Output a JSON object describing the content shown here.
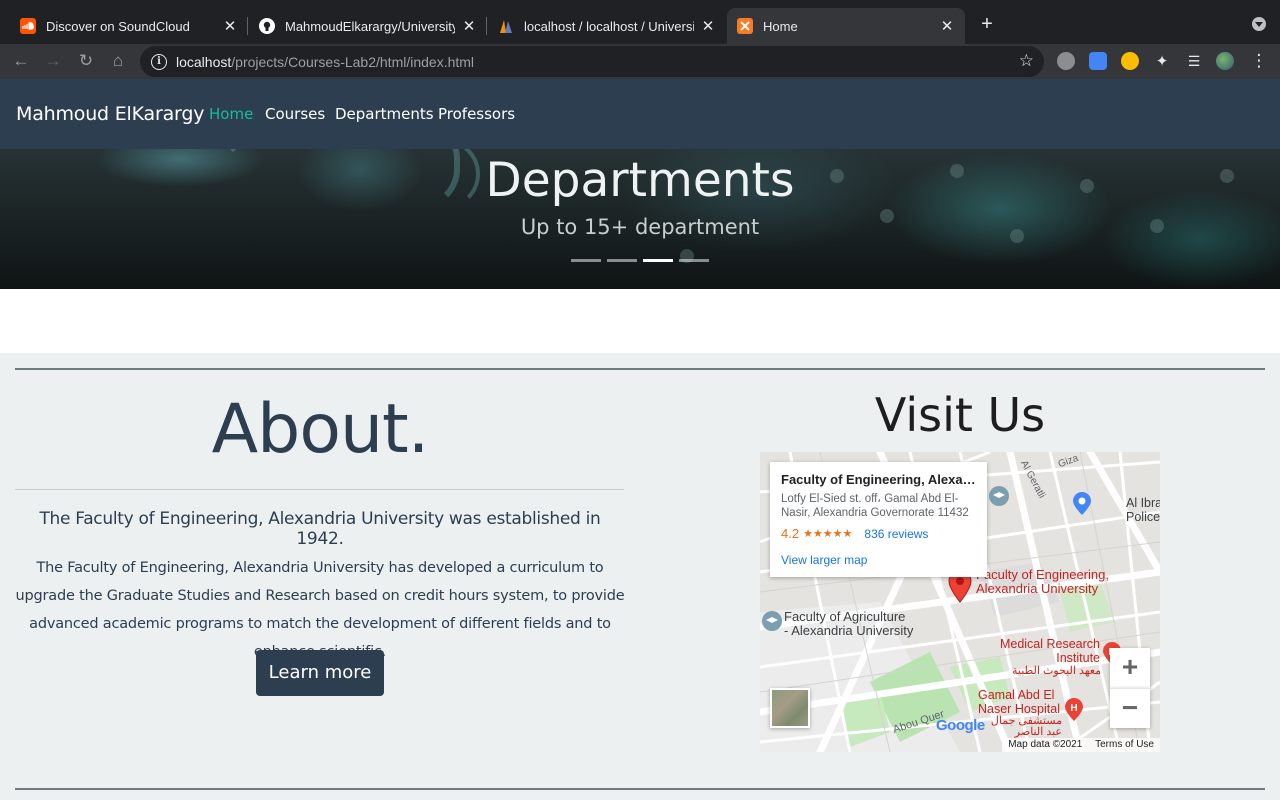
{
  "browser": {
    "tabs": [
      {
        "title": "Discover on SoundCloud",
        "favicon": "soundcloud-icon",
        "active": false
      },
      {
        "title": "MahmoudElkarargy/University-",
        "favicon": "github-icon",
        "active": false
      },
      {
        "title": "localhost / localhost / Universit",
        "favicon": "phpmyadmin-icon",
        "active": false
      },
      {
        "title": "Home",
        "favicon": "xampp-icon",
        "active": true
      }
    ],
    "url_host": "localhost",
    "url_path": "/projects/Courses-Lab2/html/index.html"
  },
  "nav": {
    "brand": "Mahmoud ElKarargy",
    "links": [
      {
        "label": "Home",
        "active": true
      },
      {
        "label": "Courses",
        "active": false
      },
      {
        "label": "Departments",
        "active": false
      },
      {
        "label": "Professors",
        "active": false
      }
    ]
  },
  "hero": {
    "title": "Departments",
    "subtitle": "Up to 15+ department",
    "slide_count": 4,
    "active_slide": 3
  },
  "about": {
    "title": "About.",
    "lead": "The Faculty of Engineering, Alexandria University was established in 1942.",
    "body": "The Faculty of Engineering, Alexandria University has developed a curriculum to upgrade the Graduate Studies and Research based on credit hours system, to provide advanced academic programs to match the development of different fields and to enhance scientific.",
    "button": "Learn more"
  },
  "visit": {
    "title": "Visit Us",
    "map": {
      "place_name": "Faculty of Engineering, Alexan...",
      "address": "Lotfy El-Sied st. off، Gamal Abd El-Nasir, Alexandria Governorate 11432",
      "rating": "4.2",
      "stars": "★★★★★",
      "reviews": "836 reviews",
      "larger_map": "View larger map",
      "labels": {
        "pin": "Faculty of Engineering,\nAlexandria University",
        "agriculture": "Faculty of Agriculture\n- Alexandria University",
        "medical": "Medical Research\nInstitute",
        "medical_ar": "معهد البحوث الطبية",
        "hospital": "Gamal Abd El\nNaser Hospital",
        "hospital_ar": "مستشفى جمال\nعبد الناصر",
        "police": "Al Ibra\nPolice",
        "street1": "Al Geratli",
        "street2": "Giza",
        "street3": "Abou Quer",
        "google": "Google"
      },
      "zoom_in": "+",
      "zoom_out": "−",
      "map_data": "Map data ©2021",
      "terms": "Terms of Use"
    }
  },
  "colors": {
    "navbar": "#2c3e50",
    "accent": "#18bc9c",
    "page_bg": "#ecf0f1",
    "rating": "#e7711b",
    "link": "#1a73e8"
  }
}
